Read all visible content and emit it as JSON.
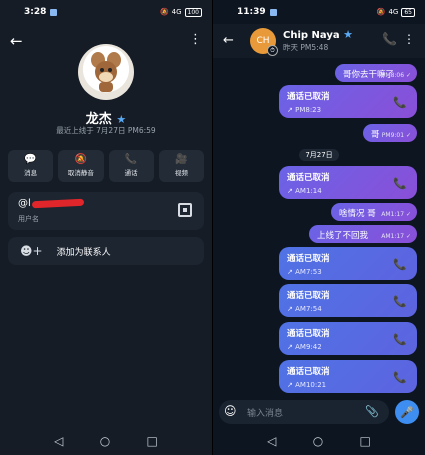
{
  "left": {
    "status": {
      "time": "3:28",
      "network": "4G",
      "battery": "100"
    },
    "profile": {
      "name": "龙杰",
      "last_seen": "最近上线于 7月27日 PM6:59"
    },
    "actions": [
      {
        "label": "消息",
        "icon": "message-icon"
      },
      {
        "label": "取消静音",
        "icon": "unmute-icon"
      },
      {
        "label": "通话",
        "icon": "phone-icon"
      },
      {
        "label": "视频",
        "icon": "video-icon"
      }
    ],
    "username": {
      "prefix": "@l",
      "label": "用户名"
    },
    "add_contact": "添加为联系人"
  },
  "right": {
    "status": {
      "time": "11:39",
      "network": "4G",
      "battery": "65"
    },
    "chat": {
      "name": "Chip Naya",
      "subtitle": "昨天 PM5:48",
      "avatar_initials": "CH"
    },
    "messages": [
      {
        "kind": "text",
        "text": "哥你去干嘛了",
        "time": "PM8:06"
      },
      {
        "kind": "call",
        "title": "通话已取消",
        "time": "PM8:23"
      },
      {
        "kind": "text",
        "text": "哥",
        "time": "PM9:01"
      },
      {
        "kind": "date",
        "text": "7月27日"
      },
      {
        "kind": "call",
        "title": "通话已取消",
        "time": "AM1:14"
      },
      {
        "kind": "text",
        "text": "啥情况 哥",
        "time": "AM1:17"
      },
      {
        "kind": "text",
        "text": "上线了不回我",
        "time": "AM1:17"
      },
      {
        "kind": "call",
        "title": "通话已取消",
        "time": "AM7:53"
      },
      {
        "kind": "call",
        "title": "通话已取消",
        "time": "AM7:54"
      },
      {
        "kind": "call",
        "title": "通话已取消",
        "time": "AM9:42"
      },
      {
        "kind": "call",
        "title": "通话已取消",
        "time": "AM10:21"
      }
    ],
    "input_placeholder": "输入消息"
  }
}
